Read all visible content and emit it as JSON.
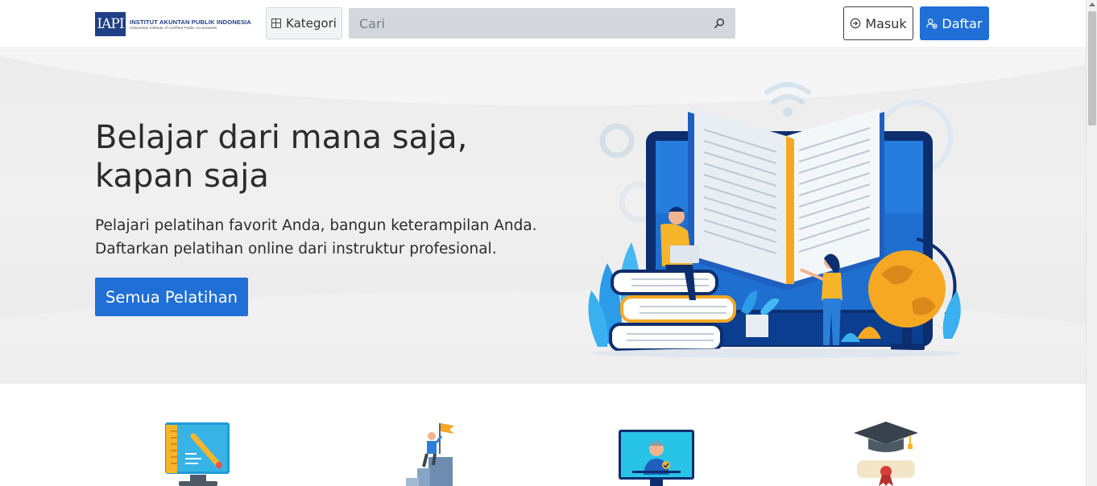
{
  "header": {
    "logo": {
      "mark": "IAPI",
      "name": "INSTITUT AKUNTAN PUBLIK INDONESIA",
      "subtitle": "Indonesian Institute of Certified Public Accountants"
    },
    "category_label": "Kategori",
    "search_placeholder": "Cari",
    "login_label": "Masuk",
    "register_label": "Daftar"
  },
  "hero": {
    "title_line1": "Belajar dari mana saja,",
    "title_line2": "kapan saja",
    "text_line1": "Pelajari pelatihan favorit Anda, bangun keterampilan Anda.",
    "text_line2": "Daftarkan pelatihan online dari instruktur profesional.",
    "cta_label": "Semua Pelatihan"
  },
  "features": [
    {
      "icon": "drawing-board-icon"
    },
    {
      "icon": "career-stairs-flag-icon"
    },
    {
      "icon": "online-instructor-screen-icon"
    },
    {
      "icon": "graduation-cap-diploma-icon"
    }
  ],
  "colors": {
    "primary": "#1f6fd6",
    "logo_blue": "#1f3f86",
    "hero_bg": "#ececec"
  }
}
